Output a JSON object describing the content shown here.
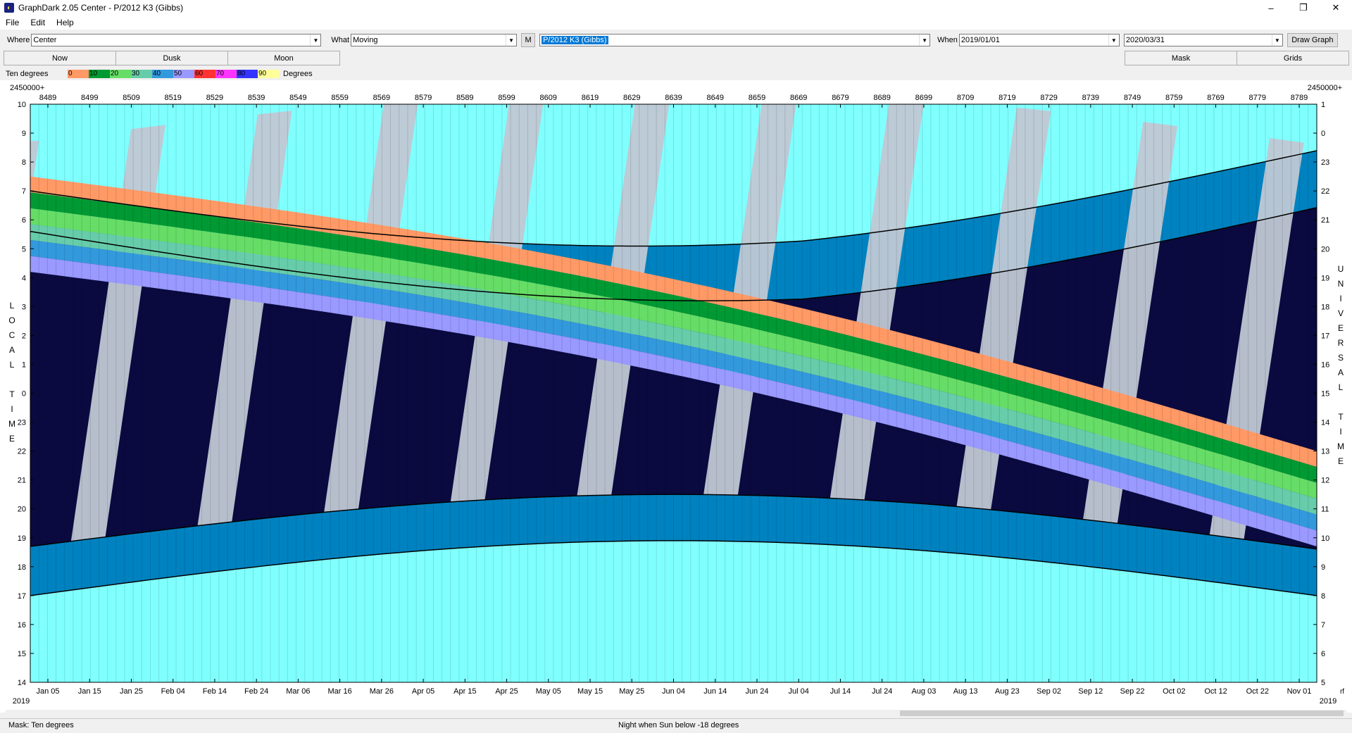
{
  "window": {
    "title": "GraphDark 2.05  Center  -  P/2012 K3 (Gibbs)",
    "minimize": "–",
    "restore": "❐",
    "close": "✕"
  },
  "menu": [
    "File",
    "Edit",
    "Help"
  ],
  "toolbar": {
    "where_label": "Where",
    "where_value": "Center",
    "what_label": "What",
    "what_value": "Moving",
    "m_button": "M",
    "object_value": "P/2012 K3 (Gibbs)",
    "when_label": "When",
    "when_start": "2019/01/01",
    "when_end": "2020/03/31",
    "draw_button": "Draw Graph"
  },
  "tabs": {
    "now": "Now",
    "dusk": "Dusk",
    "moon": "Moon",
    "mask": "Mask",
    "grids": "Grids"
  },
  "legend": {
    "label": "Ten degrees",
    "units": "Degrees",
    "bands": [
      {
        "label": "0",
        "color": "#ff9966"
      },
      {
        "label": "10",
        "color": "#009933"
      },
      {
        "label": "20",
        "color": "#66dd66"
      },
      {
        "label": "30",
        "color": "#66ccaa"
      },
      {
        "label": "40",
        "color": "#3399dd"
      },
      {
        "label": "50",
        "color": "#9999ff"
      },
      {
        "label": "60",
        "color": "#ff3333"
      },
      {
        "label": "70",
        "color": "#ff33ff"
      },
      {
        "label": "80",
        "color": "#3333ff"
      },
      {
        "label": "90",
        "color": "#ffff99"
      }
    ]
  },
  "chart_data": {
    "type": "heatmap",
    "top_axis_prefix": "2450000+",
    "top_axis_prefix_right": "2450000+",
    "julian_ticks": [
      "8489",
      "8499",
      "8509",
      "8519",
      "8529",
      "8539",
      "8549",
      "8559",
      "8569",
      "8579",
      "8589",
      "8599",
      "8609",
      "8619",
      "8629",
      "8639",
      "8649",
      "8659",
      "8669",
      "8679",
      "8689",
      "8699",
      "8709",
      "8719",
      "8729",
      "8739",
      "8749",
      "8759",
      "8769",
      "8779",
      "8789"
    ],
    "date_ticks": [
      "Jan 05",
      "Jan 15",
      "Jan 25",
      "Feb 04",
      "Feb 14",
      "Feb 24",
      "Mar 06",
      "Mar 16",
      "Mar 26",
      "Apr 05",
      "Apr 15",
      "Apr 25",
      "May 05",
      "May 15",
      "May 25",
      "Jun 04",
      "Jun 14",
      "Jun 24",
      "Jul 04",
      "Jul 14",
      "Jul 24",
      "Aug 03",
      "Aug 13",
      "Aug 23",
      "Sep 02",
      "Sep 12",
      "Sep 22",
      "Oct 02",
      "Oct 12",
      "Oct 22",
      "Nov 01"
    ],
    "year_left": "2019",
    "year_right": "2019",
    "right_corner": "rf",
    "left_axis_ticks": [
      "10",
      "9",
      "8",
      "7",
      "6",
      "5",
      "4",
      "3",
      "2",
      "1",
      "0",
      "23",
      "22",
      "21",
      "20",
      "19",
      "18",
      "17",
      "16",
      "15",
      "14"
    ],
    "right_axis_ticks": [
      "1",
      "0",
      "23",
      "22",
      "21",
      "20",
      "19",
      "18",
      "17",
      "16",
      "15",
      "14",
      "13",
      "12",
      "11",
      "10",
      "9",
      "8",
      "7",
      "6",
      "5"
    ],
    "left_axis_label": [
      "L",
      "O",
      "C",
      "A",
      "L",
      "",
      "T",
      "I",
      "M",
      "E"
    ],
    "right_axis_label": [
      "U",
      "N",
      "I",
      "V",
      "E",
      "R",
      "S",
      "A",
      "L",
      "",
      "T",
      "I",
      "M",
      "E"
    ],
    "colors": {
      "day": "#80ffff",
      "night": "#0a0a40",
      "twilight": "#0082c0",
      "moonlight": "#c0c8d4"
    }
  },
  "status": {
    "left": "Mask:  Ten degrees",
    "center": "Night when Sun below -18 degrees"
  }
}
